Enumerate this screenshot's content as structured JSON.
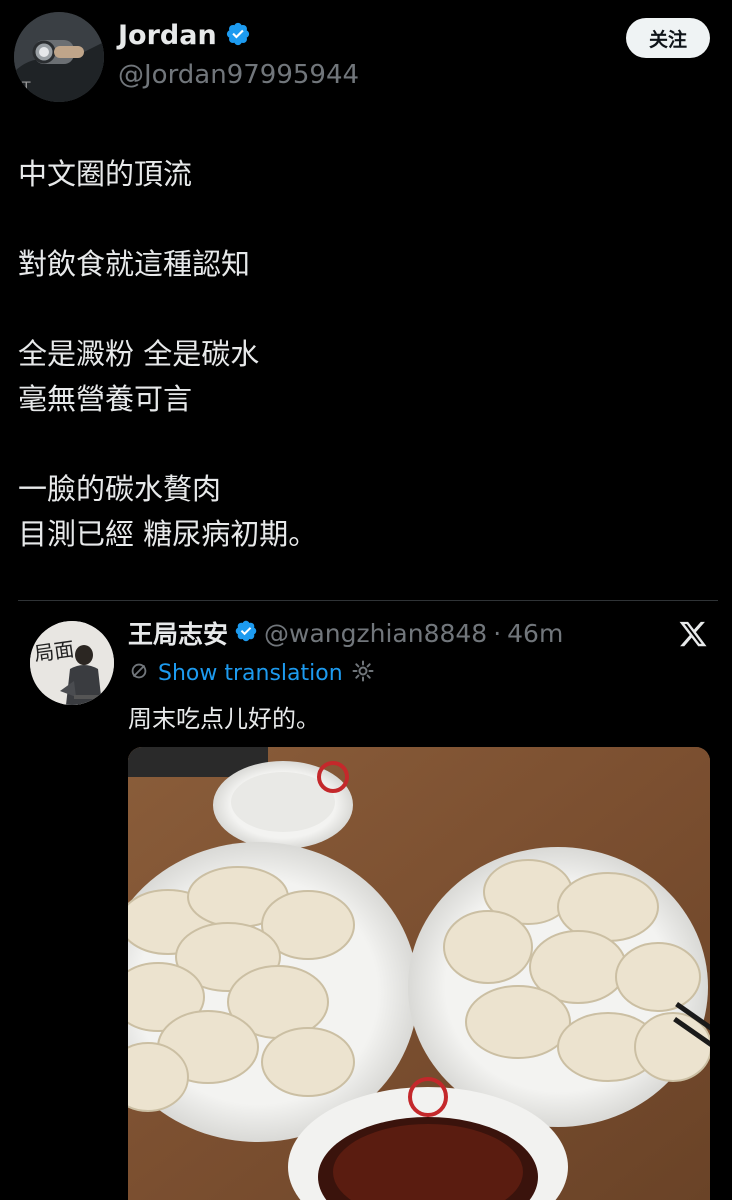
{
  "post": {
    "display_name": "Jordan",
    "handle": "@Jordan97995944",
    "follow_label": "关注",
    "verified": true,
    "paragraphs": [
      [
        "中文圈的頂流"
      ],
      [
        "對飲食就這種認知"
      ],
      [
        "全是澱粉 全是碳水",
        "毫無營養可言"
      ],
      [
        "一臉的碳水贅肉",
        "目測已經 糖尿病初期。"
      ]
    ]
  },
  "quoted": {
    "display_name": "王局志安",
    "handle": "@wangzhian8848",
    "separator": "·",
    "time": "46m",
    "translate_label": "Show translation",
    "text": "周末吃点儿好的。",
    "avatar_lettering": "局面",
    "photo_description_icon": "dumplings-photo"
  },
  "colors": {
    "background": "#000000",
    "text": "#e7e9ea",
    "muted": "#71767b",
    "link": "#1d9bf0",
    "verified": "#1d9bf0",
    "follow_bg": "#eff3f4"
  }
}
